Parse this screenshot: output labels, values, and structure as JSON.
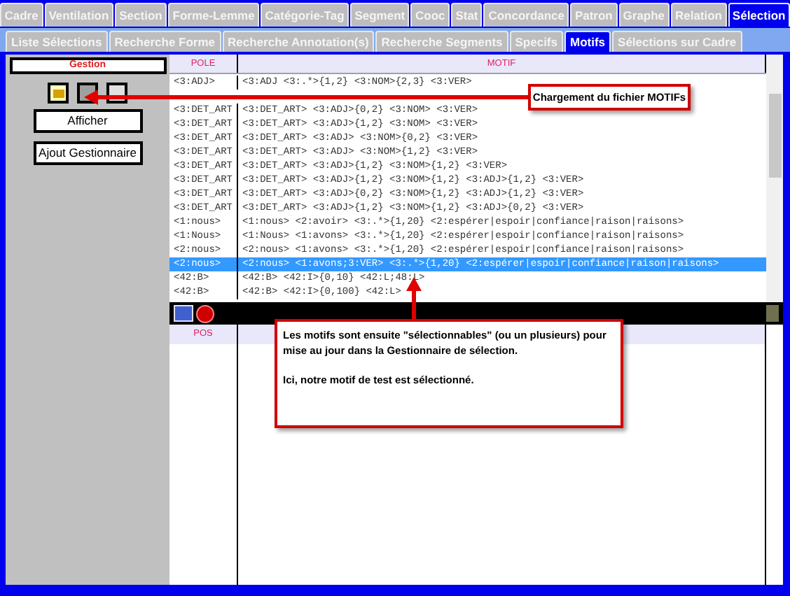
{
  "top_tabs": [
    {
      "label": "Cadre",
      "selected": false
    },
    {
      "label": "Ventilation",
      "selected": false
    },
    {
      "label": "Section",
      "selected": false
    },
    {
      "label": "Forme-Lemme",
      "selected": false
    },
    {
      "label": "Catégorie-Tag",
      "selected": false
    },
    {
      "label": "Segment",
      "selected": false
    },
    {
      "label": "Cooc",
      "selected": false
    },
    {
      "label": "Stat",
      "selected": false
    },
    {
      "label": "Concordance",
      "selected": false
    },
    {
      "label": "Patron",
      "selected": false
    },
    {
      "label": "Graphe",
      "selected": false
    },
    {
      "label": "Relation",
      "selected": false
    },
    {
      "label": "Sélection",
      "selected": true
    }
  ],
  "sub_tabs": [
    {
      "label": "Liste Sélections",
      "selected": false
    },
    {
      "label": "Recherche Forme",
      "selected": false
    },
    {
      "label": "Recherche Annotation(s)",
      "selected": false
    },
    {
      "label": "Recherche Segments",
      "selected": false
    },
    {
      "label": "Specifs",
      "selected": false
    },
    {
      "label": "Motifs",
      "selected": true
    },
    {
      "label": "Sélections sur Cadre",
      "selected": false
    }
  ],
  "gestion": {
    "title": "Gestion",
    "buttons": [
      "Afficher",
      "Ajout Gestionnaire"
    ]
  },
  "table": {
    "columns": [
      "POLE",
      "MOTIF"
    ],
    "rows": [
      {
        "pole": "<3:ADJ>",
        "motif": "<3:ADJ <3:.*>{1,2} <3:NOM>{2,3} <3:VER>",
        "selected": false
      },
      {
        "pole": "<3:DET_ART",
        "motif": "<3:DET_ART> <3:ADJ>{0,2} <3:NOM> <3:VER>",
        "selected": false
      },
      {
        "pole": "<3:DET_ART",
        "motif": "<3:DET_ART> <3:ADJ>{1,2} <3:NOM> <3:VER>",
        "selected": false
      },
      {
        "pole": "<3:DET_ART",
        "motif": "<3:DET_ART> <3:ADJ> <3:NOM>{0,2} <3:VER>",
        "selected": false
      },
      {
        "pole": "<3:DET_ART",
        "motif": "<3:DET_ART> <3:ADJ> <3:NOM>{1,2} <3:VER>",
        "selected": false
      },
      {
        "pole": "<3:DET_ART",
        "motif": "<3:DET_ART> <3:ADJ>{1,2} <3:NOM>{1,2} <3:VER>",
        "selected": false
      },
      {
        "pole": "<3:DET_ART",
        "motif": "<3:DET_ART> <3:ADJ>{1,2} <3:NOM>{1,2} <3:ADJ>{1,2} <3:VER>",
        "selected": false
      },
      {
        "pole": "<3:DET_ART",
        "motif": "<3:DET_ART> <3:ADJ>{0,2} <3:NOM>{1,2} <3:ADJ>{1,2} <3:VER>",
        "selected": false
      },
      {
        "pole": "<3:DET_ART",
        "motif": "<3:DET_ART> <3:ADJ>{1,2} <3:NOM>{1,2} <3:ADJ>{0,2} <3:VER>",
        "selected": false
      },
      {
        "pole": "<1:nous>",
        "motif": "<1:nous> <2:avoir> <3:.*>{1,20} <2:espérer|espoir|confiance|raison|raisons>",
        "selected": false
      },
      {
        "pole": "<1:Nous>",
        "motif": "<1:Nous> <1:avons> <3:.*>{1,20} <2:espérer|espoir|confiance|raison|raisons>",
        "selected": false
      },
      {
        "pole": "<2:nous>",
        "motif": "<2:nous> <1:avons> <3:.*>{1,20} <2:espérer|espoir|confiance|raison|raisons>",
        "selected": false
      },
      {
        "pole": "<2:nous>",
        "motif": "<2:nous> <1:avons;3:VER> <3:.*>{1,20} <2:espérer|espoir|confiance|raison|raisons>",
        "selected": true
      },
      {
        "pole": "<42:B>",
        "motif": "<42:B> <42:I>{0,10} <42:L;48:L>",
        "selected": false
      },
      {
        "pole": "<42:B>",
        "motif": "<42:B> <42:I>{0,100} <42:L>",
        "selected": false
      }
    ]
  },
  "lower_table": {
    "columns": [
      "POS"
    ]
  },
  "callouts": [
    {
      "paragraphs": [
        "Chargement du fichier MOTIFs"
      ]
    },
    {
      "paragraphs": [
        "Les motifs sont ensuite \"sélectionnables\" (ou un plusieurs) pour mise au jour dans la Gestionnaire de sélection.",
        "Ici, notre motif de test est sélectionné."
      ]
    }
  ]
}
